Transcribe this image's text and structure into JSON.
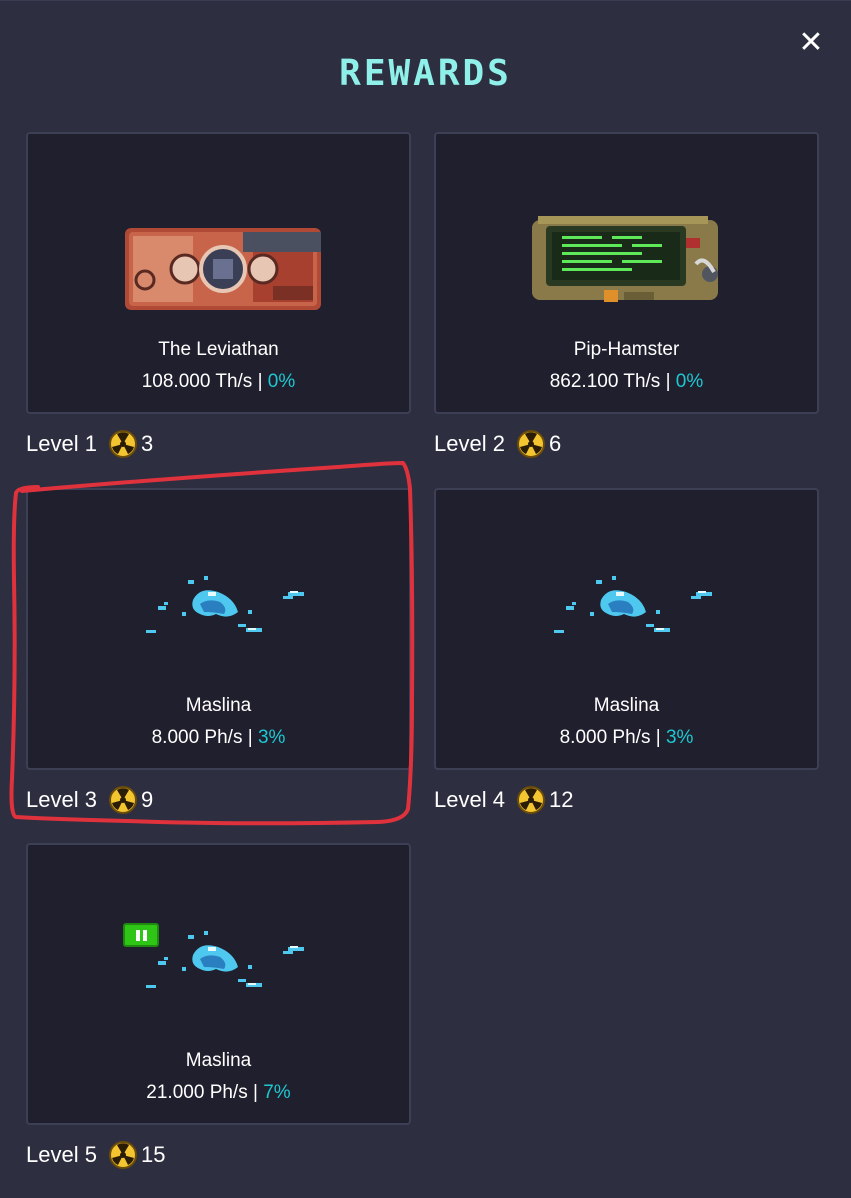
{
  "modal": {
    "title": "REWARDS",
    "close_icon": "close-icon"
  },
  "colors": {
    "title": "#8ff0ea",
    "percent": "#1ec8d2",
    "card_bg": "#1f1f2d",
    "highlight": "#e0323c"
  },
  "rewards": [
    {
      "name": "The Leviathan",
      "rate": "108.000 Th/s",
      "sep": " | ",
      "percent": "0%",
      "level": "Level 1",
      "cost": "3",
      "icon": "leviathan-image"
    },
    {
      "name": "Pip-Hamster",
      "rate": "862.100 Th/s",
      "sep": " | ",
      "percent": "0%",
      "level": "Level 2",
      "cost": "6",
      "icon": "pip-hamster-image"
    },
    {
      "name": "Maslina",
      "rate": "8.000 Ph/s",
      "sep": " | ",
      "percent": "3%",
      "level": "Level 3",
      "cost": "9",
      "icon": "maslina-image"
    },
    {
      "name": "Maslina",
      "rate": "8.000 Ph/s",
      "sep": " | ",
      "percent": "3%",
      "level": "Level 4",
      "cost": "12",
      "icon": "maslina-image"
    },
    {
      "name": "Maslina",
      "rate": "21.000 Ph/s",
      "sep": " | ",
      "percent": "7%",
      "level": "Level 5",
      "cost": "15",
      "icon": "maslina-image"
    }
  ]
}
